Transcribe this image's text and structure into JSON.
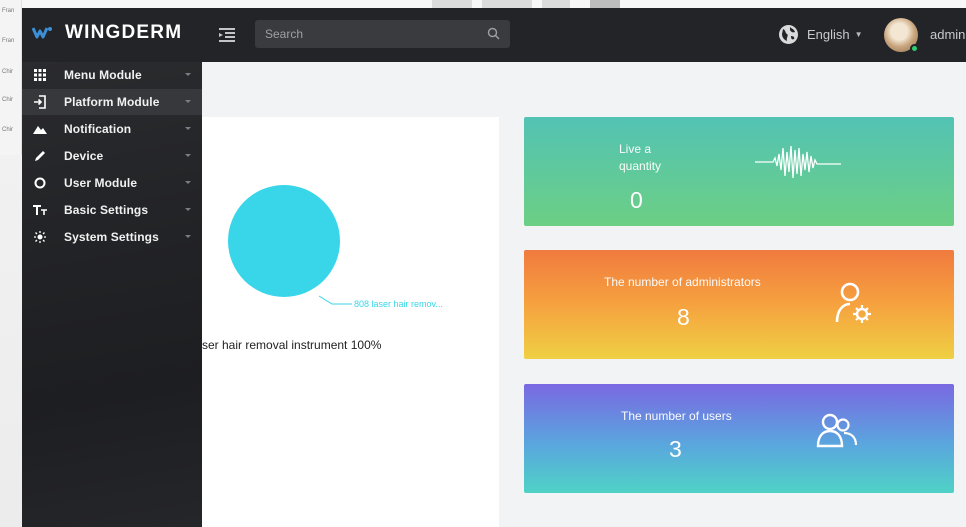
{
  "background": {
    "sheet_rows": [
      "Fran",
      "Fran",
      "Chir",
      "Chir",
      "Chir"
    ]
  },
  "header": {
    "brand": "WINGDERM",
    "search_placeholder": "Search",
    "language": "English",
    "admin": "admin"
  },
  "sidebar": {
    "items": [
      {
        "label": "Menu Module",
        "icon": "grid-icon"
      },
      {
        "label": "Platform Module",
        "icon": "login-icon"
      },
      {
        "label": "Notification",
        "icon": "mountain-icon"
      },
      {
        "label": "Device",
        "icon": "pencil-icon"
      },
      {
        "label": "User Module",
        "icon": "circle-icon"
      },
      {
        "label": "Basic Settings",
        "icon": "text-size-icon"
      },
      {
        "label": "System Settings",
        "icon": "sun-icon"
      }
    ],
    "active_index": 1
  },
  "pie": {
    "slice_label": "808 laser hair remov...",
    "legend": "ser hair removal instrument 100%",
    "color": "#38d6e8",
    "share_percent": 100
  },
  "cards": {
    "live": {
      "label_line1": "Live a",
      "label_line2": "quantity",
      "value": "0",
      "icon": "waveform-icon"
    },
    "admins": {
      "label": "The number of administrators",
      "value": "8",
      "icon": "user-gear-icon"
    },
    "users": {
      "label": "The number of users",
      "value": "3",
      "icon": "users-icon"
    }
  },
  "colors": {
    "topbar": "#232427",
    "sidebar": "#222326",
    "card_live": "#53c3b4",
    "card_admins": "#f07a3f",
    "card_users": "#7a68e2"
  }
}
